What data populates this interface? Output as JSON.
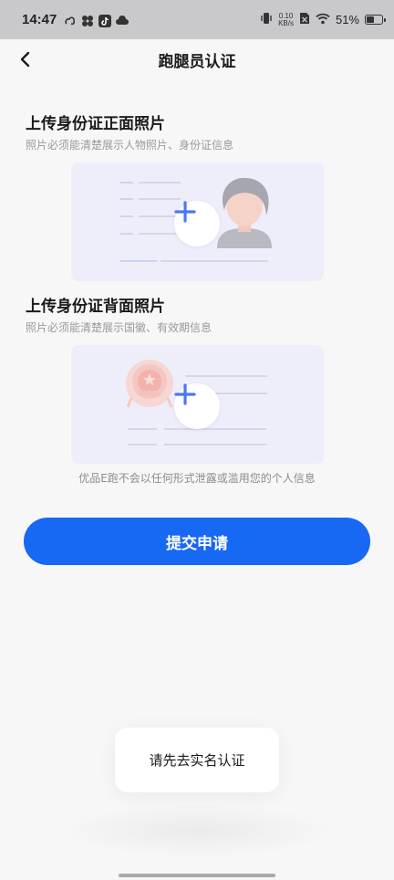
{
  "status_bar": {
    "time": "14:47",
    "net_speed_value": "0.10",
    "net_speed_unit": "KB/s",
    "battery": "51%",
    "battery_level": 0.51,
    "icons": [
      "cloud-sync-icon",
      "flower-app-icon",
      "tiktok-icon",
      "cloud-icon",
      "vibrate-icon",
      "no-sim-icon",
      "wifi-icon",
      "battery-icon"
    ]
  },
  "nav": {
    "title": "跑腿员认证",
    "back_icon": "chevron-left-icon"
  },
  "front_section": {
    "title": "上传身份证正面照片",
    "hint": "照片必须能清楚展示人物照片、身份证信息"
  },
  "back_section": {
    "title": "上传身份证背面照片",
    "hint": "照片必须能清楚展示国徽、有效期信息"
  },
  "privacy_note": "优品E跑不会以任何形式泄露或滥用您的个人信息",
  "submit_label": "提交申请",
  "toast": "请先去实名认证",
  "colors": {
    "primary": "#1768f2",
    "card_bg": "#eeeefa",
    "plus": "#4a78f0"
  }
}
